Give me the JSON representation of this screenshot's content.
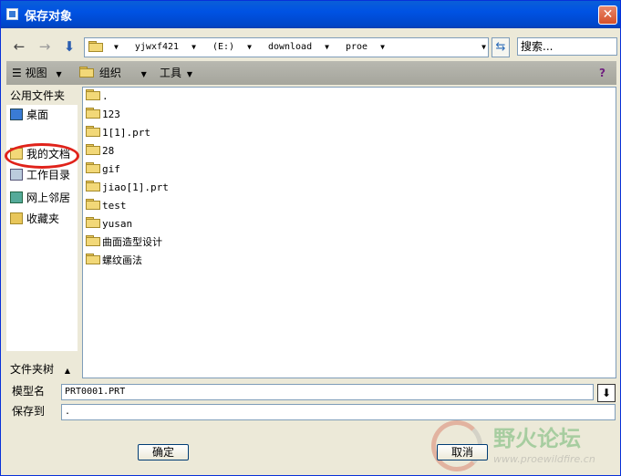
{
  "window": {
    "title": "保存对象",
    "close_label": "✕"
  },
  "nav": {
    "back_icon": "←",
    "forward_icon": "→",
    "up_icon": "⬇",
    "path": [
      "yjwxf421",
      "(E:)",
      "download",
      "proe"
    ],
    "refresh_icon": "⇆",
    "search_placeholder": "搜索..."
  },
  "toolbar": {
    "view": "视图",
    "organize": "组织",
    "tools": "工具",
    "help_icon": "?"
  },
  "sidebar": {
    "heading": "公用文件夹",
    "items": [
      {
        "label": "桌面",
        "icon": "desktop-icon"
      },
      {
        "label": "我的文档",
        "icon": "my-documents-icon"
      },
      {
        "label": "工作目录",
        "icon": "working-directory-icon"
      },
      {
        "label": "网上邻居",
        "icon": "network-icon"
      },
      {
        "label": "收藏夹",
        "icon": "favorites-icon"
      }
    ],
    "tree_label": "文件夹树",
    "tree_caret": "▲"
  },
  "files": [
    ".",
    "123",
    "1[1].prt",
    "28",
    "gif",
    "jiao[1].prt",
    "test",
    "yusan",
    "曲面造型设计",
    "螺纹画法"
  ],
  "form": {
    "model_name_label": "模型名",
    "model_name_value": "PRT0001.PRT",
    "save_to_label": "保存到",
    "save_to_value": "."
  },
  "buttons": {
    "ok": "确定",
    "cancel": "取消"
  },
  "watermark": {
    "title": "野火论坛",
    "url": "www.proewildfire.cn"
  },
  "colors": {
    "titlebar": "#0052e3",
    "highlight_circle": "#e0221a",
    "dialog_bg": "#ece9d8"
  }
}
